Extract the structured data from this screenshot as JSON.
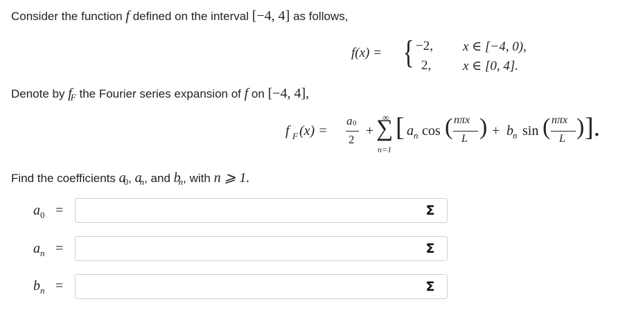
{
  "problem": {
    "intro_prefix": "Consider the function",
    "intro_func": "f",
    "intro_mid": "defined on the interval",
    "intro_interval": "[−4, 4]",
    "intro_suffix": "as follows,",
    "piecewise": {
      "lhs": "f(x) =",
      "case1_value": "−2,",
      "case1_cond": "x ∈ [−4, 0),",
      "case2_value": "2,",
      "case2_cond": "x ∈ [0, 4]."
    },
    "denote_prefix": "Denote by",
    "denote_func": "f",
    "denote_sub": "F",
    "denote_mid": "the Fourier series expansion of",
    "denote_f": "f",
    "denote_on": "on",
    "denote_interval": "[−4, 4],",
    "series": {
      "lhs": "f",
      "lhs_sub": "F",
      "lhs_arg": "(x) =",
      "a0_num": "a",
      "a0_sub": "0",
      "a0_den": "2",
      "plus": "+",
      "sum_top": "∞",
      "sum_sign": "∑",
      "sum_bottom": "n=1",
      "bracket_open": "[",
      "an": "a",
      "an_sub": "n",
      "cos": "cos",
      "arg_num": "nπx",
      "arg_den": "L",
      "plus2": "+",
      "bn": "b",
      "bn_sub": "n",
      "sin": "sin",
      "bracket_close": "]."
    },
    "find_prefix": "Find the coefficients",
    "find_a0": "a",
    "find_a0_sub": "0",
    "find_an": "a",
    "find_an_sub": "n",
    "find_and": "and",
    "find_bn": "b",
    "find_bn_sub": "n",
    "find_suffix": ", with",
    "find_cond": "n ⩾ 1."
  },
  "answers": [
    {
      "label": "a",
      "sub": "0",
      "eq": "=",
      "value": "",
      "sigma": "Σ"
    },
    {
      "label": "a",
      "sub": "n",
      "eq": "=",
      "value": "",
      "sigma": "Σ"
    },
    {
      "label": "b",
      "sub": "n",
      "eq": "=",
      "value": "",
      "sigma": "Σ"
    }
  ]
}
